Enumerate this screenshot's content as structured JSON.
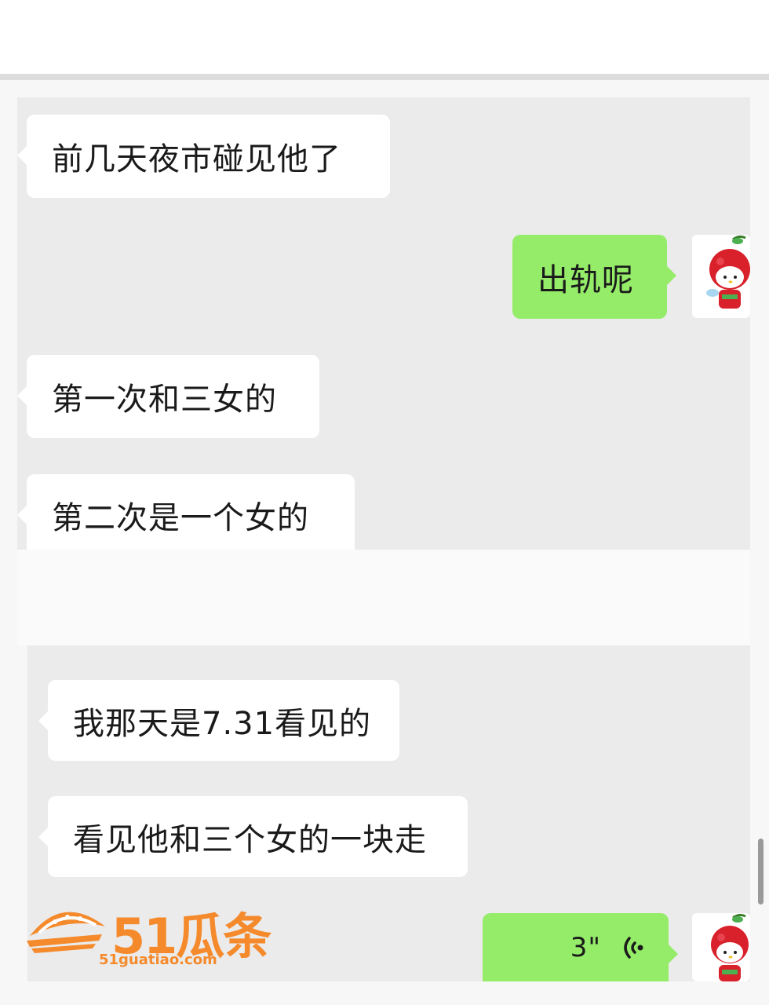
{
  "messages": [
    {
      "direction": "incoming",
      "text": "前几天夜市碰见他了"
    },
    {
      "direction": "outgoing",
      "text": "出轨呢"
    },
    {
      "direction": "incoming",
      "text": "第一次和三女的"
    },
    {
      "direction": "incoming",
      "text": "第二次是一个女的"
    },
    {
      "direction": "incoming",
      "text": "我那天是7.31看见的"
    },
    {
      "direction": "incoming",
      "text": "看见他和三个女的一块走"
    },
    {
      "direction": "outgoing",
      "type": "voice",
      "duration": "3\""
    }
  ],
  "watermark": {
    "brand": "51瓜条",
    "url": "51guatiao.com"
  },
  "colors": {
    "incoming_bubble": "#ffffff",
    "outgoing_bubble": "#95ec69",
    "chat_background": "#ebebeb",
    "watermark": "#f58a2c"
  },
  "icons": {
    "avatar": "cherry-character-avatar",
    "voice": "voice-wave-icon",
    "watermark_logo": "watermelon-logo"
  }
}
